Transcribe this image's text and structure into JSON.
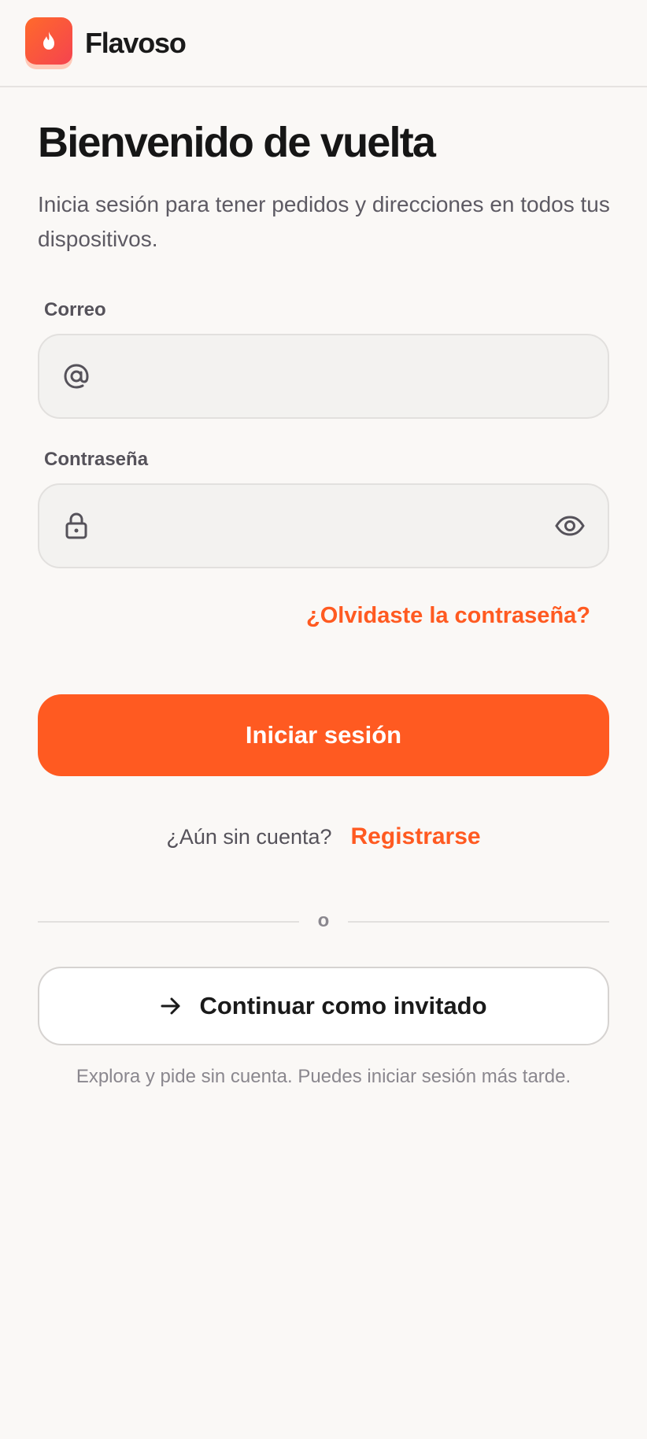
{
  "app": {
    "brand_name": "Flavoso",
    "logo_icon": "flame-icon",
    "accent_color": "#ff5a21"
  },
  "page": {
    "title": "Bienvenido de vuelta",
    "subtitle": "Inicia sesión para tener pedidos y direcciones en todos tus dispositivos."
  },
  "form": {
    "email": {
      "label": "Correo",
      "value": "",
      "placeholder": "",
      "icon": "at-sign-icon"
    },
    "password": {
      "label": "Contraseña",
      "value": "",
      "placeholder": "",
      "icon": "lock-icon",
      "toggle_icon": "eye-icon"
    },
    "forgot_password": "¿Olvidaste la contraseña?",
    "submit_label": "Iniciar sesión"
  },
  "register": {
    "question": "¿Aún sin cuenta?",
    "link_label": "Registrarse"
  },
  "divider": {
    "label": "o"
  },
  "guest": {
    "icon": "arrow-right-icon",
    "label": "Continuar como invitado",
    "note": "Explora y pide sin cuenta. Puedes iniciar sesión más tarde."
  }
}
